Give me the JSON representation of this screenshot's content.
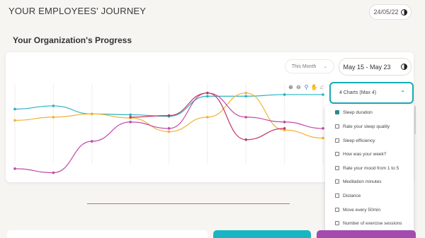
{
  "header": {
    "title": "YOUR EMPLOYEES' JOURNEY",
    "date": "24/05/22"
  },
  "section": {
    "title": "Your Organization's Progress"
  },
  "filters": {
    "period": "This Month",
    "range": "May 15 - May 23"
  },
  "toolbar": {
    "icons": [
      "zoom-in-icon",
      "zoom-out-icon",
      "magnify-icon",
      "pan-hand-icon",
      "home-icon"
    ]
  },
  "dropdown": {
    "label": "4 Charts (Max 4)",
    "options": [
      {
        "label": "Sleep duration",
        "checked": true
      },
      {
        "label": "Rate your sleep quality",
        "checked": false
      },
      {
        "label": "Sleep efficiency",
        "checked": false
      },
      {
        "label": "How was your week?",
        "checked": false
      },
      {
        "label": "Rate your mood from 1 to 5",
        "checked": false
      },
      {
        "label": "Meditation minutes",
        "checked": false
      },
      {
        "label": "Distance",
        "checked": false
      },
      {
        "label": "Move every 50min",
        "checked": false
      },
      {
        "label": "Number of exercise sessions",
        "checked": false
      }
    ]
  },
  "colors": {
    "teal": "#27b3c0",
    "orange": "#f2b233",
    "magenta": "#c04aa8",
    "crimson": "#c0395e",
    "card_teal": "#17b6c2",
    "card_purple": "#a44bb0"
  },
  "chart_data": {
    "type": "line",
    "x": [
      1,
      2,
      3,
      4,
      5,
      6,
      7,
      8,
      9
    ],
    "ylim": [
      0,
      100
    ],
    "series": [
      {
        "values": [
          68,
          72,
          62,
          61,
          59,
          84,
          84,
          86,
          86
        ]
      },
      {
        "values": [
          54,
          58,
          62,
          57,
          40,
          58,
          88,
          42,
          32
        ]
      },
      {
        "values": [
          -6,
          -11,
          28,
          52,
          44,
          88,
          58,
          52,
          44
        ]
      },
      {
        "values": [
          null,
          null,
          null,
          58,
          60,
          88,
          30,
          44,
          null
        ]
      }
    ]
  }
}
